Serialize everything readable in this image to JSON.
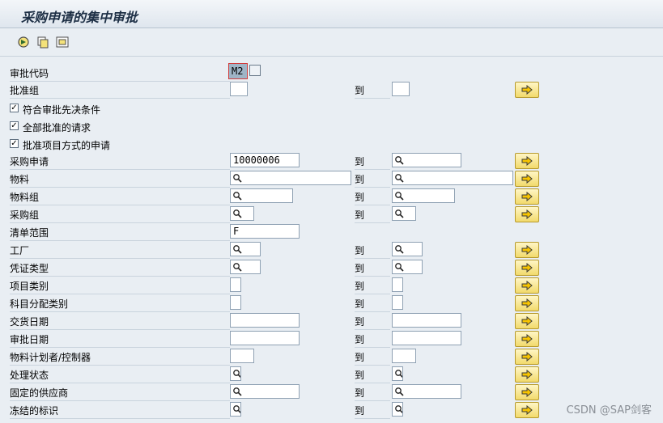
{
  "window": {
    "title": "采购申请的集中审批"
  },
  "toolbar": [
    {
      "name": "execute-icon",
      "tooltip": ""
    },
    {
      "name": "get-variant-icon",
      "tooltip": ""
    },
    {
      "name": "selection-options-icon",
      "tooltip": ""
    }
  ],
  "header_field": {
    "label": "审批代码",
    "value": "M2"
  },
  "to_label": "到",
  "rows": {
    "approval_group": {
      "label": "批准组",
      "from": "",
      "to": ""
    },
    "cb1": {
      "label": "符合审批先决条件",
      "checked": true
    },
    "cb2": {
      "label": "全部批准的请求",
      "checked": true
    },
    "cb3": {
      "label": "批准项目方式的申请",
      "checked": true
    },
    "purchase_req": {
      "label": "采购申请",
      "from": "10000006",
      "to": ""
    },
    "material": {
      "label": "物料",
      "from": "",
      "to": ""
    },
    "material_group": {
      "label": "物料组",
      "from": "",
      "to": ""
    },
    "purchasing_group": {
      "label": "采购组",
      "from": "",
      "to": ""
    },
    "list_scope": {
      "label": "清单范围",
      "value": "F"
    },
    "plant": {
      "label": "工厂",
      "from": "",
      "to": ""
    },
    "doc_type": {
      "label": "凭证类型",
      "from": "",
      "to": ""
    },
    "item_category": {
      "label": "项目类别",
      "from": "",
      "to": ""
    },
    "account_assignment": {
      "label": "科目分配类别",
      "from": "",
      "to": ""
    },
    "delivery_date": {
      "label": "交货日期",
      "from": "",
      "to": ""
    },
    "approval_date": {
      "label": "审批日期",
      "from": "",
      "to": ""
    },
    "mrp_controller": {
      "label": "物料计划者/控制器",
      "from": "",
      "to": ""
    },
    "processing_status": {
      "label": "处理状态",
      "from": "",
      "to": ""
    },
    "fixed_vendor": {
      "label": "固定的供应商",
      "from": "",
      "to": ""
    },
    "blocked_flag": {
      "label": "冻结的标识",
      "from": "",
      "to": ""
    }
  },
  "watermark": "CSDN @SAP剑客",
  "colors": {
    "arrow_button": "#f2da6c",
    "title_bg": "#dfe6ee",
    "focus_border": "#d23b3b"
  }
}
